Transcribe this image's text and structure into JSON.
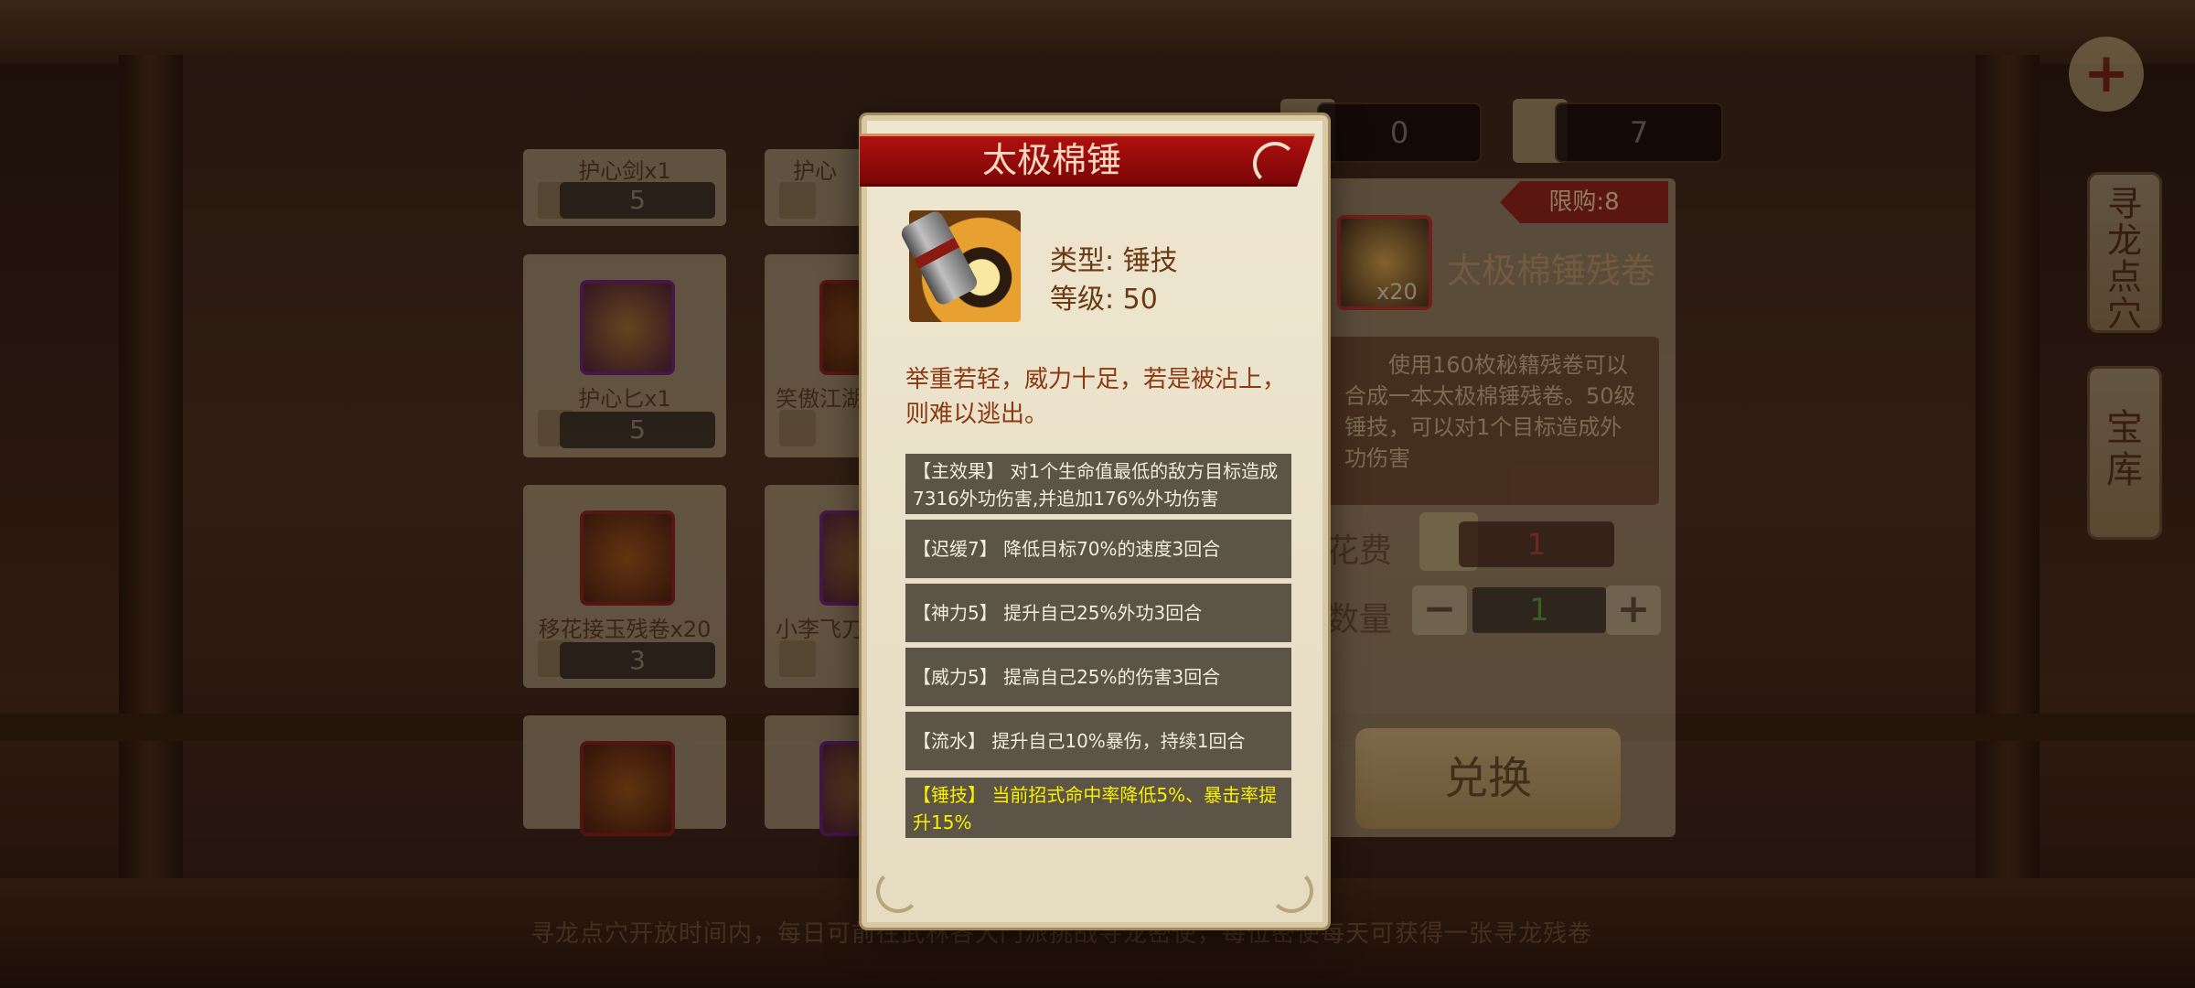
{
  "items": [
    {
      "name": "护心剑x1",
      "price": "5"
    },
    {
      "name": "护心",
      "price": ""
    },
    {
      "name": "护心匕x1",
      "price": "5"
    },
    {
      "name": "笑傲江湖",
      "price": ""
    },
    {
      "name": "移花接玉残卷x20",
      "price": "3"
    },
    {
      "name": "小李飞刀",
      "price": ""
    }
  ],
  "currency": {
    "amount1": "0",
    "amount2": "7"
  },
  "detail": {
    "limit": "限购:8",
    "title": "太极棉锤残卷",
    "qty": "x20",
    "desc": "使用160枚秘籍残卷可以合成一本太极棉锤残卷。50级锤技，可以对1个目标造成外功伤害",
    "cost_label": "花费",
    "cost_value": "1",
    "qty_label": "数量",
    "qty_value": "1",
    "minus": "−",
    "plus": "+",
    "exchange": "兑换"
  },
  "side_tabs": [
    "寻龙点穴",
    "宝库"
  ],
  "add_button": "+",
  "bottom_tip": "寻龙点穴开放时间内，每日可前往武林各大门派挑战寻龙密使，每位密使每天可获得一张寻龙残卷",
  "popup": {
    "title": "太极棉锤",
    "type": "类型: 锤技",
    "level": "等级: 50",
    "flavor": "举重若轻，威力十足，若是被沾上，则难以逃出。",
    "effects": [
      "【主效果】 对1个生命值最低的敌方目标造成7316外功伤害,并追加176%外功伤害",
      "【迟缓7】 降低目标70%的速度3回合",
      "【神力5】 提升自己25%外功3回合",
      "【威力5】 提高自己25%的伤害3回合",
      "【流水】 提升自己10%暴伤，持续1回合",
      "【锤技】 当前招式命中率降低5%、暴击率提升15%"
    ]
  }
}
